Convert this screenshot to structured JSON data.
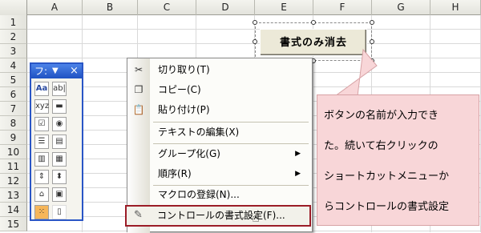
{
  "columns": [
    "A",
    "B",
    "C",
    "D",
    "E",
    "F",
    "G",
    "H"
  ],
  "rows": [
    "1",
    "2",
    "3",
    "4",
    "5",
    "6",
    "7",
    "8",
    "9",
    "10",
    "11",
    "12",
    "13",
    "14",
    "15"
  ],
  "form_button": {
    "label": "書式のみ消去"
  },
  "toolbox": {
    "title": "フ:",
    "dropdown_glyph": "▼",
    "close_glyph": "×"
  },
  "menu": {
    "items": [
      {
        "label": "切り取り(T)",
        "icon": "scissors-icon"
      },
      {
        "label": "コピー(C)",
        "icon": "copy-icon"
      },
      {
        "label": "貼り付け(P)",
        "icon": "paste-icon"
      },
      {
        "label": "テキストの編集(X)"
      },
      {
        "label": "グループ化(G)",
        "submenu": true
      },
      {
        "label": "順序(R)",
        "submenu": true
      },
      {
        "label": "マクロの登録(N)..."
      },
      {
        "label": "コントロールの書式設定(F)...",
        "icon": "format-control-icon",
        "highlighted": true
      }
    ]
  },
  "callout": {
    "lines": [
      "ボタンの名前が入力でき",
      "た。続いて右クリックの",
      "ショートカットメニューか",
      "らコントロールの書式設定"
    ]
  },
  "colors": {
    "accent_red": "#9b1c27",
    "callout_bg": "#f8d6d8",
    "toolbar_blue": "#2a56c6"
  }
}
